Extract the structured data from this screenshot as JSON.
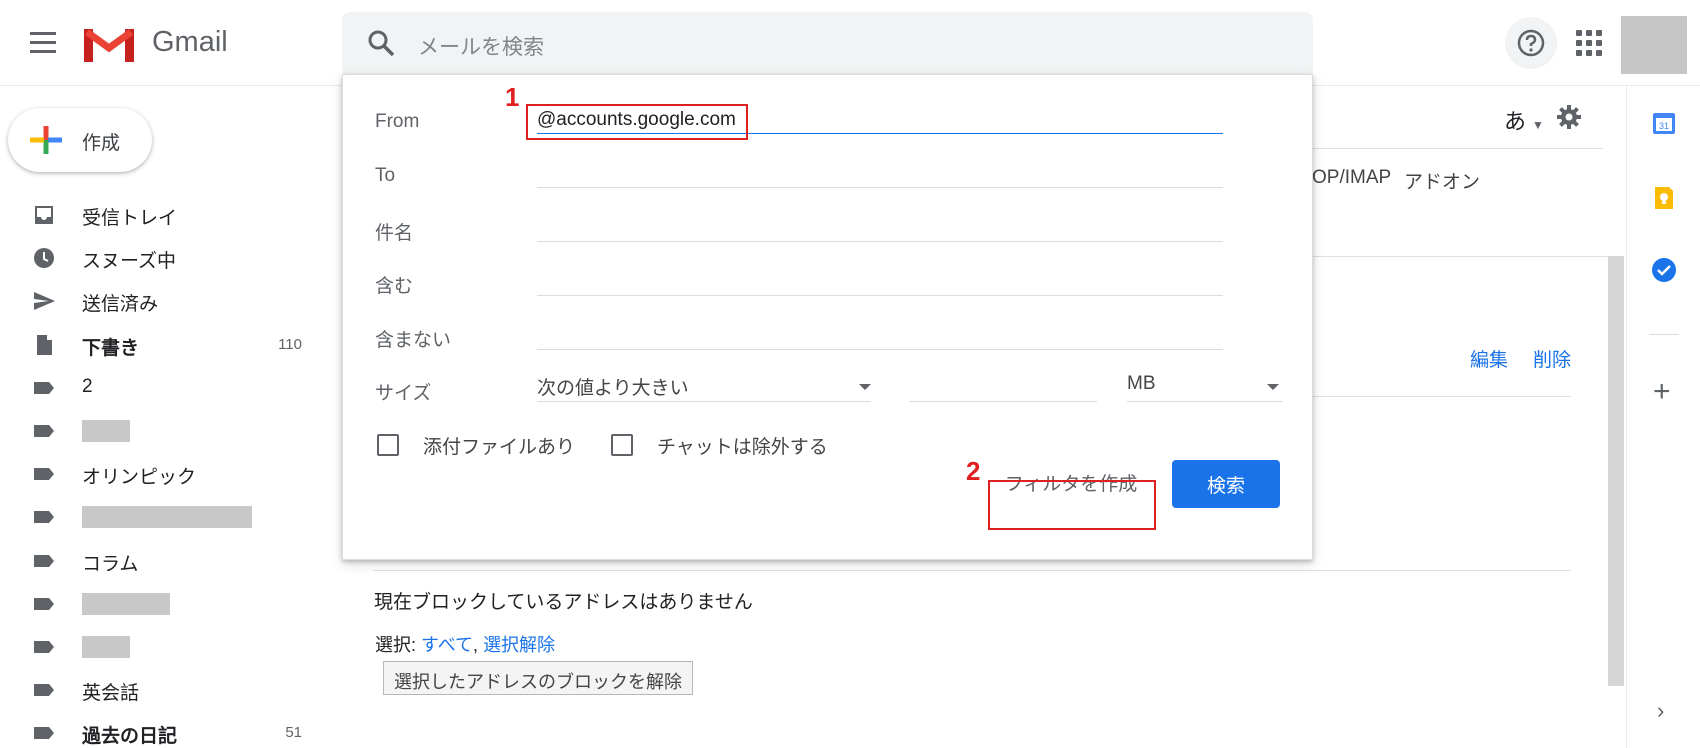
{
  "header": {
    "app_name": "Gmail",
    "search_placeholder": "メールを検索"
  },
  "compose": {
    "label": "作成"
  },
  "sidebar": {
    "items": [
      {
        "label": "受信トレイ",
        "icon": "inbox-icon",
        "count": "",
        "bold": false
      },
      {
        "label": "スヌーズ中",
        "icon": "clock-icon",
        "count": "",
        "bold": false
      },
      {
        "label": "送信済み",
        "icon": "send-icon",
        "count": "",
        "bold": false
      },
      {
        "label": "下書き",
        "icon": "draft-icon",
        "count": "110",
        "bold": true
      },
      {
        "label": "2",
        "icon": "label-icon",
        "count": "",
        "bold": false
      },
      {
        "label": "",
        "icon": "label-icon",
        "count": "",
        "bold": false
      },
      {
        "label": "オリンピック",
        "icon": "label-icon",
        "count": "",
        "bold": false
      },
      {
        "label": "",
        "icon": "label-icon",
        "count": "",
        "bold": false
      },
      {
        "label": "コラム",
        "icon": "label-icon",
        "count": "",
        "bold": false
      },
      {
        "label": "",
        "icon": "label-icon",
        "count": "",
        "bold": false
      },
      {
        "label": "",
        "icon": "label-icon",
        "count": "",
        "bold": false
      },
      {
        "label": "英会話",
        "icon": "label-icon",
        "count": "",
        "bold": false
      },
      {
        "label": "過去の日記",
        "icon": "label-icon",
        "count": "51",
        "bold": true
      }
    ]
  },
  "settings": {
    "lang": "あ",
    "tab_pop": "OP/IMAP",
    "tab_addon": "アドオン",
    "edit": "編集",
    "delete": "削除",
    "no_blocked": "現在ブロックしているアドレスはありません",
    "select_prefix": "選択: ",
    "select_all": "すべて",
    "select_sep": ", ",
    "select_none": "選択解除",
    "unblock_button": "選択したアドレスのブロックを解除"
  },
  "search_dropdown": {
    "from_label": "From",
    "from_value": "@accounts.google.com",
    "to_label": "To",
    "subject_label": "件名",
    "has_words_label": "含む",
    "not_has_label": "含まない",
    "size_label": "サイズ",
    "size_comparator": "次の値より大きい",
    "size_unit": "MB",
    "has_attachment_label": "添付ファイルあり",
    "exclude_chats_label": "チャットは除外する",
    "create_filter_button": "フィルタを作成",
    "search_button": "検索"
  },
  "annotations": {
    "step1": "1",
    "step2": "2"
  },
  "colors": {
    "accent": "#1a73e8",
    "annotation": "#e02020"
  }
}
